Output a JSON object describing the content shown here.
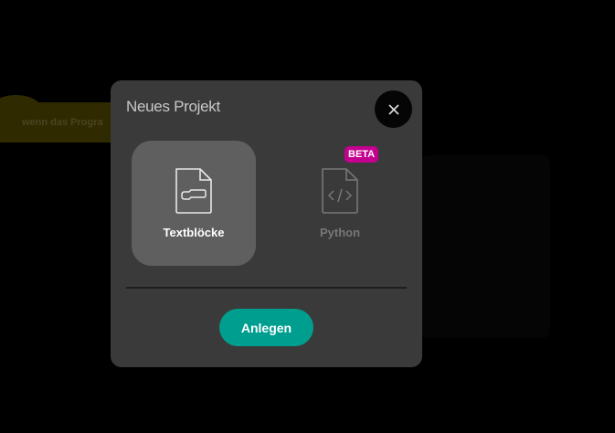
{
  "background": {
    "block_text": "wenn das Progra"
  },
  "dialog": {
    "title": "Neues Projekt",
    "close_icon": "close-icon",
    "options": [
      {
        "label": "Textblöcke",
        "icon": "file-block-icon",
        "selected": true
      },
      {
        "label": "Python",
        "icon": "file-code-icon",
        "selected": false,
        "badge": "BETA"
      }
    ],
    "create_label": "Anlegen"
  },
  "colors": {
    "accent": "#009e8e",
    "badge": "#c4008f",
    "modal": "#3a3a3a",
    "selected_card": "#5f5f5f"
  }
}
